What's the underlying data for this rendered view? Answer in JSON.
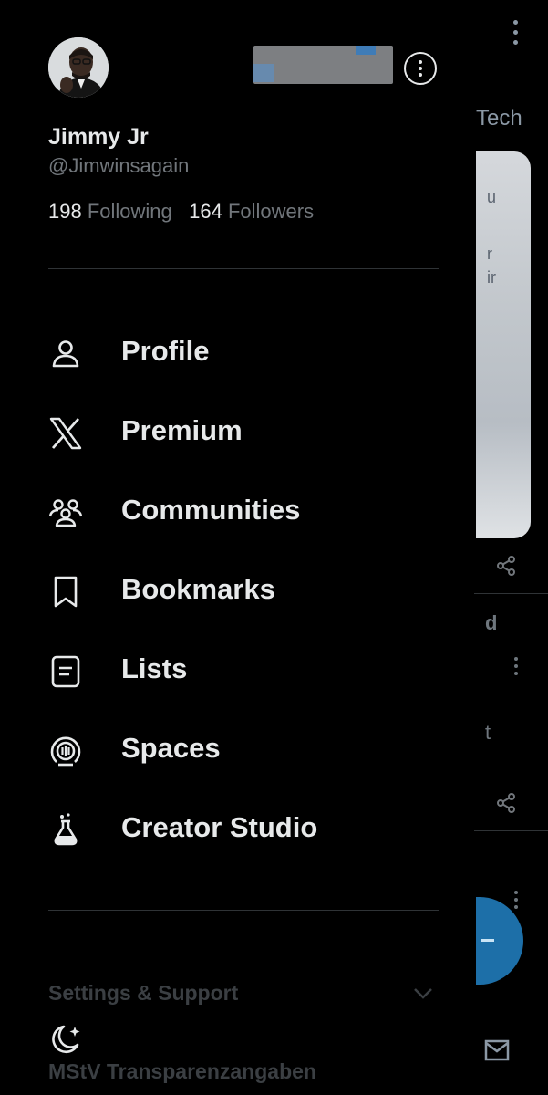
{
  "background_feed": {
    "tab_text": "Tech",
    "image_snippets": [
      "u",
      "r",
      "ir"
    ],
    "post_snippets": [
      "d",
      "t"
    ],
    "colors": {
      "fab": "#1d6fa8"
    }
  },
  "profile": {
    "display_name": "Jimmy Jr",
    "handle": "@Jimwinsagain",
    "following_count": "198",
    "following_label": "Following",
    "followers_count": "164",
    "followers_label": "Followers"
  },
  "menu": {
    "items": [
      {
        "label": "Profile",
        "icon": "person-icon"
      },
      {
        "label": "Premium",
        "icon": "x-logo-icon"
      },
      {
        "label": "Communities",
        "icon": "communities-icon"
      },
      {
        "label": "Bookmarks",
        "icon": "bookmark-icon"
      },
      {
        "label": "Lists",
        "icon": "list-icon"
      },
      {
        "label": "Spaces",
        "icon": "microphone-icon"
      },
      {
        "label": "Creator Studio",
        "icon": "flask-icon"
      }
    ]
  },
  "footer": {
    "settings_label": "Settings & Support",
    "transparency_label": "MStV Transparenzangaben",
    "theme_icon": "moon-icon"
  },
  "colors": {
    "background": "#000000",
    "text_primary": "#e7e9ea",
    "text_secondary": "#71767b",
    "divider": "#2f3336"
  }
}
